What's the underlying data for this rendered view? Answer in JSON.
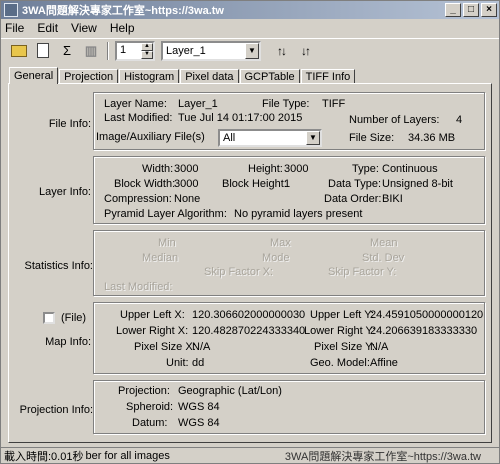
{
  "window": {
    "title": "3WA問題解決專家工作室~https://3wa.tw"
  },
  "menu": [
    {
      "label": "File"
    },
    {
      "label": "Edit"
    },
    {
      "label": "View"
    },
    {
      "label": "Help"
    }
  ],
  "toolbar": {
    "icons": [
      "open-folder-icon",
      "new-document-icon",
      "sigma-icon",
      "histogram-icon",
      "sort-ascending-icon",
      "sort-descending-icon"
    ],
    "sigma": "Σ",
    "band_value": "1",
    "layer_select": "Layer_1"
  },
  "tabs": [
    {
      "label": "General",
      "active": true
    },
    {
      "label": "Projection"
    },
    {
      "label": "Histogram"
    },
    {
      "label": "Pixel data"
    },
    {
      "label": "GCPTable"
    },
    {
      "label": "TIFF Info"
    }
  ],
  "file_info": {
    "section_label": "File Info:",
    "layer_name_label": "Layer Name:",
    "layer_name": "Layer_1",
    "file_type_label": "File Type:",
    "file_type": "TIFF",
    "last_modified_label": "Last Modified:",
    "last_modified": "Tue Jul 14 01:17:00 2015",
    "num_layers_label": "Number of Layers:",
    "num_layers": "4",
    "aux_label": "Image/Auxiliary File(s)",
    "aux_value": "All",
    "file_size_label": "File Size:",
    "file_size": "34.36 MB"
  },
  "layer_info": {
    "section_label": "Layer Info:",
    "width_label": "Width:",
    "width": "3000",
    "height_label": "Height:",
    "height": "3000",
    "type_label": "Type:",
    "type": "Continuous",
    "block_width_label": "Block Width:",
    "block_width": "3000",
    "block_height_label": "Block Height:",
    "block_height": "1",
    "data_type_label": "Data Type:",
    "data_type": "Unsigned 8-bit",
    "compression_label": "Compression:",
    "compression": "None",
    "data_order_label": "Data Order:",
    "data_order": "BIKI",
    "pyramid_label": "Pyramid Layer Algorithm:",
    "pyramid": "No pyramid layers present"
  },
  "statistics_info": {
    "section_label": "Statistics Info:",
    "min_label": "Min",
    "max_label": "Max",
    "mean_label": "Mean",
    "median_label": "Median",
    "mode_label": "Mode",
    "std_dev_label": "Std. Dev",
    "skip_x_label": "Skip Factor X:",
    "skip_y_label": "Skip Factor Y:",
    "last_modified_label": "Last Modified:"
  },
  "map_info": {
    "section_label": "Map Info:",
    "file_checkbox_label": "(File)",
    "upper_left_x_label": "Upper Left X:",
    "upper_left_x": "120.306602000000030",
    "upper_left_y_label": "Upper Left Y:",
    "upper_left_y": "24.4591050000000120",
    "lower_right_x_label": "Lower Right X:",
    "lower_right_x": "120.482870224333340",
    "lower_right_y_label": "Lower Right Y:",
    "lower_right_y": "24.206639183333330",
    "pixel_size_x_label": "Pixel Size X:",
    "pixel_size_x": "N/A",
    "pixel_size_y_label": "Pixel Size Y:",
    "pixel_size_y": "N/A",
    "unit_label": "Unit:",
    "unit": "dd",
    "geo_model_label": "Geo. Model:",
    "geo_model": "Affine"
  },
  "projection_info": {
    "section_label": "Projection Info:",
    "projection_label": "Projection:",
    "projection": "Geographic (Lat/Lon)",
    "spheroid_label": "Spheroid:",
    "spheroid": "WGS 84",
    "datum_label": "Datum:",
    "datum": "WGS 84"
  },
  "status": {
    "text": "載入時間:0.01秒",
    "hint": "ber for all images",
    "watermark": "3WA問題解決專家工作室~https://3wa.tw"
  }
}
